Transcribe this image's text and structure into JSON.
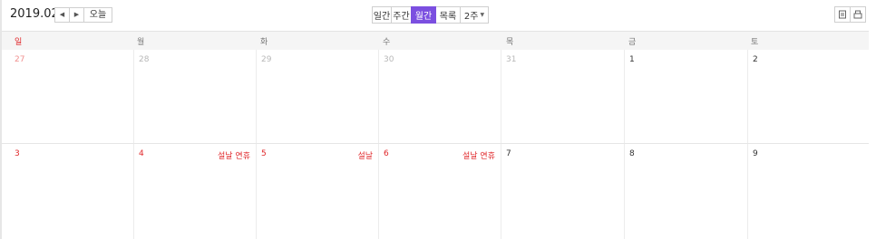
{
  "header": {
    "title": "2019.02",
    "prev_icon": "caret-left",
    "next_icon": "caret-right",
    "today_label": "오늘",
    "views": [
      {
        "label": "일간",
        "active": false
      },
      {
        "label": "주간",
        "active": false
      },
      {
        "label": "월간",
        "active": true
      },
      {
        "label": "목록",
        "active": false
      },
      {
        "label": "2주",
        "active": false,
        "dropdown": true
      }
    ],
    "actions": [
      "print-icon",
      "calendar-print-icon"
    ]
  },
  "calendar": {
    "weekdays": [
      "일",
      "월",
      "화",
      "수",
      "목",
      "금",
      "토"
    ],
    "weeks": [
      [
        {
          "date": "27",
          "state": "prev-sunday"
        },
        {
          "date": "28",
          "state": "prev"
        },
        {
          "date": "29",
          "state": "prev"
        },
        {
          "date": "30",
          "state": "prev"
        },
        {
          "date": "31",
          "state": "prev"
        },
        {
          "date": "1",
          "state": "normal"
        },
        {
          "date": "2",
          "state": "normal"
        }
      ],
      [
        {
          "date": "3",
          "state": "sunday"
        },
        {
          "date": "4",
          "state": "holiday",
          "holiday": "설날 연휴"
        },
        {
          "date": "5",
          "state": "holiday",
          "holiday": "설날"
        },
        {
          "date": "6",
          "state": "holiday",
          "holiday": "설날 연휴"
        },
        {
          "date": "7",
          "state": "normal"
        },
        {
          "date": "8",
          "state": "normal"
        },
        {
          "date": "9",
          "state": "normal"
        }
      ]
    ]
  },
  "colors": {
    "accent": "#7b4fe0",
    "holiday": "#e0272a",
    "muted": "#b8b8b8"
  }
}
